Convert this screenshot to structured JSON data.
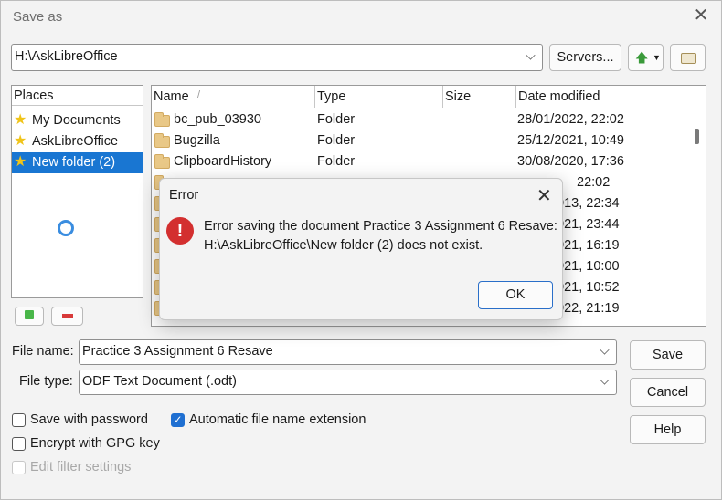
{
  "window": {
    "title": "Save as"
  },
  "path": {
    "value": "H:\\AskLibreOffice"
  },
  "toolbar": {
    "servers_label": "Servers..."
  },
  "places": {
    "header": "Places",
    "items": [
      {
        "label": "My Documents"
      },
      {
        "label": "AskLibreOffice"
      },
      {
        "label": "New folder (2)"
      }
    ]
  },
  "files": {
    "columns": [
      "Name",
      "Type",
      "Size",
      "Date modified"
    ],
    "rows": [
      {
        "name": "bc_pub_03930",
        "type": "Folder",
        "date": "28/01/2022, 22:02"
      },
      {
        "name": "Bugzilla",
        "type": "Folder",
        "date": "25/12/2021, 10:49"
      },
      {
        "name": "ClipboardHistory",
        "type": "Folder",
        "date": "30/08/2020, 17:36"
      },
      {
        "name": "",
        "type": "",
        "date": "22:02"
      },
      {
        "name": "",
        "type": "",
        "date": "013, 22:34"
      },
      {
        "name": "",
        "type": "",
        "date": "021, 23:44"
      },
      {
        "name": "",
        "type": "",
        "date": "021, 16:19"
      },
      {
        "name": "",
        "type": "",
        "date": "021, 10:00"
      },
      {
        "name": "",
        "type": "",
        "date": "021, 10:52"
      },
      {
        "name": "",
        "type": "",
        "date": "022, 21:19"
      }
    ]
  },
  "form": {
    "file_name_label": "File name:",
    "file_name_value": "Practice 3 Assignment 6 Resave",
    "file_type_label": "File type:",
    "file_type_value": "ODF Text Document (.odt)"
  },
  "buttons": {
    "save": "Save",
    "cancel": "Cancel",
    "help": "Help"
  },
  "options": {
    "save_with_password": "Save with password",
    "automatic_extension": "Automatic file name extension",
    "encrypt_gpg": "Encrypt with GPG key",
    "edit_filter": "Edit filter settings"
  },
  "error_dialog": {
    "title": "Error",
    "message_line1": "Error saving the document Practice 3 Assignment 6 Resave:",
    "message_line2": "H:\\AskLibreOffice\\New folder (2) does not exist.",
    "ok": "OK"
  }
}
